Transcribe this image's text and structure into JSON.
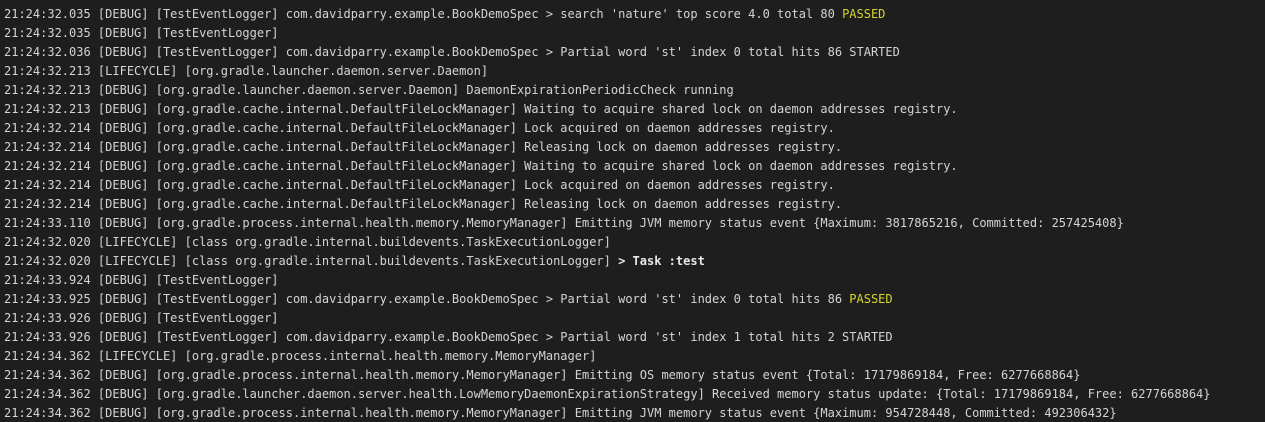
{
  "lines": [
    {
      "text": "21:24:32.035 [DEBUG] [TestEventLogger] com.davidparry.example.BookDemoSpec > search 'nature' top score 4.0 total 80 ",
      "status": "PASSED"
    },
    {
      "text": "21:24:32.035 [DEBUG] [TestEventLogger]"
    },
    {
      "text": "21:24:32.036 [DEBUG] [TestEventLogger] com.davidparry.example.BookDemoSpec > Partial word 'st' index 0 total hits 86 STARTED"
    },
    {
      "text": "21:24:32.213 [LIFECYCLE] [org.gradle.launcher.daemon.server.Daemon]"
    },
    {
      "text": "21:24:32.213 [DEBUG] [org.gradle.launcher.daemon.server.Daemon] DaemonExpirationPeriodicCheck running"
    },
    {
      "text": "21:24:32.213 [DEBUG] [org.gradle.cache.internal.DefaultFileLockManager] Waiting to acquire shared lock on daemon addresses registry."
    },
    {
      "text": "21:24:32.214 [DEBUG] [org.gradle.cache.internal.DefaultFileLockManager] Lock acquired on daemon addresses registry."
    },
    {
      "text": "21:24:32.214 [DEBUG] [org.gradle.cache.internal.DefaultFileLockManager] Releasing lock on daemon addresses registry."
    },
    {
      "text": "21:24:32.214 [DEBUG] [org.gradle.cache.internal.DefaultFileLockManager] Waiting to acquire shared lock on daemon addresses registry."
    },
    {
      "text": "21:24:32.214 [DEBUG] [org.gradle.cache.internal.DefaultFileLockManager] Lock acquired on daemon addresses registry."
    },
    {
      "text": "21:24:32.214 [DEBUG] [org.gradle.cache.internal.DefaultFileLockManager] Releasing lock on daemon addresses registry."
    },
    {
      "text": "21:24:33.110 [DEBUG] [org.gradle.process.internal.health.memory.MemoryManager] Emitting JVM memory status event {Maximum: 3817865216, Committed: 257425408}"
    },
    {
      "text": "21:24:32.020 [LIFECYCLE] [class org.gradle.internal.buildevents.TaskExecutionLogger]"
    },
    {
      "text": "21:24:32.020 [LIFECYCLE] [class org.gradle.internal.buildevents.TaskExecutionLogger] ",
      "bold": "> Task :test"
    },
    {
      "text": "21:24:33.924 [DEBUG] [TestEventLogger]"
    },
    {
      "text": "21:24:33.925 [DEBUG] [TestEventLogger] com.davidparry.example.BookDemoSpec > Partial word 'st' index 0 total hits 86 ",
      "status": "PASSED"
    },
    {
      "text": "21:24:33.926 [DEBUG] [TestEventLogger]"
    },
    {
      "text": "21:24:33.926 [DEBUG] [TestEventLogger] com.davidparry.example.BookDemoSpec > Partial word 'st' index 1 total hits 2 STARTED"
    },
    {
      "text": "21:24:34.362 [LIFECYCLE] [org.gradle.process.internal.health.memory.MemoryManager]"
    },
    {
      "text": "21:24:34.362 [DEBUG] [org.gradle.process.internal.health.memory.MemoryManager] Emitting OS memory status event {Total: 17179869184, Free: 6277668864}"
    },
    {
      "text": "21:24:34.362 [DEBUG] [org.gradle.launcher.daemon.server.health.LowMemoryDaemonExpirationStrategy] Received memory status update: {Total: 17179869184, Free: 6277668864}"
    },
    {
      "text": "21:24:34.362 [DEBUG] [org.gradle.process.internal.health.memory.MemoryManager] Emitting JVM memory status event {Maximum: 954728448, Committed: 492306432}"
    }
  ],
  "colors": {
    "background": "#1e1e1e",
    "text": "#d4d4d4",
    "passed": "#d7d52b"
  }
}
